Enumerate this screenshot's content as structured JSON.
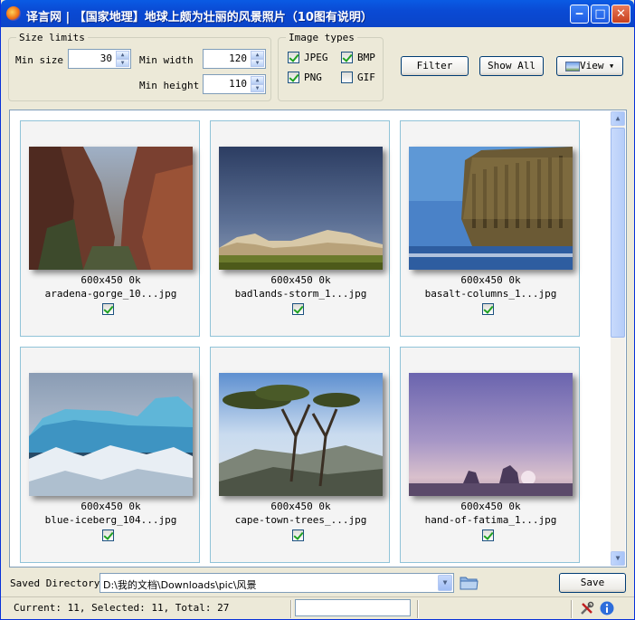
{
  "window": {
    "title": "译言网 | 【国家地理】地球上颇为壮丽的风景照片（10图有说明）"
  },
  "size_limits": {
    "label": "Size limits",
    "min_size_label": "Min size",
    "min_size": "30",
    "min_width_label": "Min width",
    "min_width": "120",
    "min_height_label": "Min height",
    "min_height": "110"
  },
  "image_types": {
    "label": "Image types",
    "jpeg": "JPEG",
    "bmp": "BMP",
    "png": "PNG",
    "gif": "GIF",
    "jpeg_checked": true,
    "bmp_checked": true,
    "png_checked": true,
    "gif_checked": false
  },
  "toolbar": {
    "filter": "Filter",
    "show_all": "Show All",
    "view": "View"
  },
  "images": [
    {
      "dims": "600x450 0k",
      "name": "aradena-gorge_10...jpg",
      "checked": true
    },
    {
      "dims": "600x450 0k",
      "name": "badlands-storm_1...jpg",
      "checked": true
    },
    {
      "dims": "600x450 0k",
      "name": "basalt-columns_1...jpg",
      "checked": true
    },
    {
      "dims": "600x450 0k",
      "name": "blue-iceberg_104...jpg",
      "checked": true
    },
    {
      "dims": "600x450 0k",
      "name": "cape-town-trees_...jpg",
      "checked": true
    },
    {
      "dims": "600x450 0k",
      "name": "hand-of-fatima_1...jpg",
      "checked": true
    }
  ],
  "footer": {
    "saved_dir_label": "Saved Directory",
    "saved_dir": "D:\\我的文档\\Downloads\\pic\\风景",
    "save": "Save"
  },
  "status": {
    "text": "Current: 11, Selected: 11, Total: 27"
  }
}
